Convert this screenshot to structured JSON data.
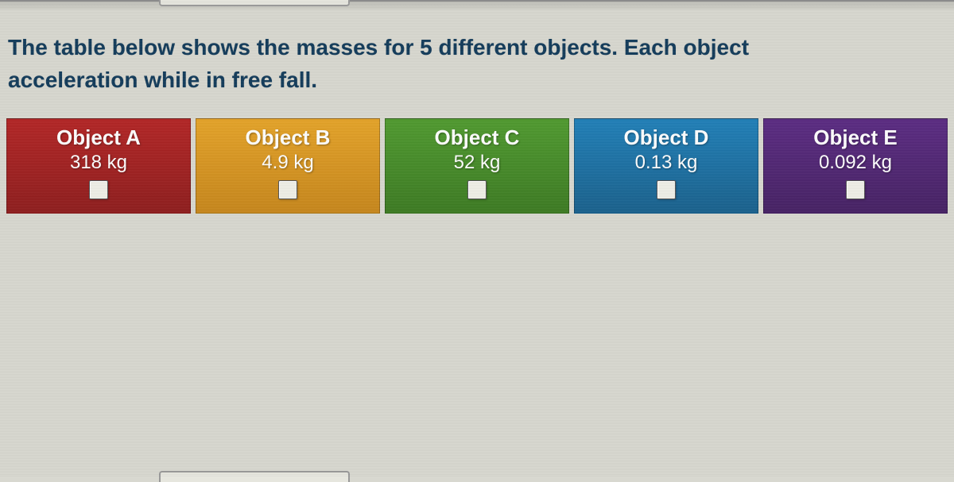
{
  "question": {
    "line1": "The table below shows the masses for 5 different objects. Each object",
    "line2": "acceleration while in free fall."
  },
  "objects": [
    {
      "name": "Object A",
      "mass": "318 kg",
      "color": "c-red"
    },
    {
      "name": "Object B",
      "mass": "4.9 kg",
      "color": "c-orange"
    },
    {
      "name": "Object C",
      "mass": "52 kg",
      "color": "c-green"
    },
    {
      "name": "Object D",
      "mass": "0.13 kg",
      "color": "c-blue"
    },
    {
      "name": "Object E",
      "mass": "0.092 kg",
      "color": "c-purple"
    }
  ]
}
